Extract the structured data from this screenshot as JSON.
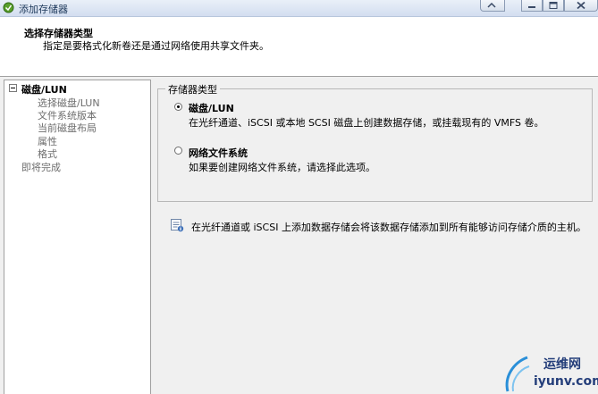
{
  "window": {
    "title": "添加存储器"
  },
  "header": {
    "title": "选择存储器类型",
    "subtitle": "指定是要格式化新卷还是通过网络使用共享文件夹。"
  },
  "nav": {
    "root": "磁盘/LUN",
    "children": [
      "选择磁盘/LUN",
      "文件系统版本",
      "当前磁盘布局",
      "属性",
      "格式"
    ],
    "finish": "即将完成"
  },
  "storage_type": {
    "legend": "存储器类型",
    "options": [
      {
        "label": "磁盘/LUN",
        "description": "在光纤通道、iSCSI 或本地 SCSI 磁盘上创建数据存储，或挂载现有的 VMFS 卷。",
        "selected": true
      },
      {
        "label": "网络文件系统",
        "description": "如果要创建网络文件系统，请选择此选项。",
        "selected": false
      }
    ]
  },
  "info": {
    "text": "在光纤通道或 iSCSI 上添加数据存储会将该数据存储添加到所有能够访问存储介质的主机。"
  },
  "watermark": {
    "site_name": "运维网",
    "url": "iyunv.com"
  },
  "colors": {
    "panel_bg": "#f0f0f0",
    "header_bg": "#ffffff",
    "disabled_text": "#6d6d6d",
    "watermark_blue": "#243e7a"
  }
}
